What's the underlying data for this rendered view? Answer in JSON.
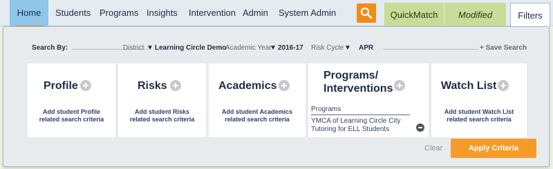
{
  "nav": {
    "items": [
      "Home",
      "Students",
      "Programs",
      "Insights",
      "Intervention",
      "Admin",
      "System Admin"
    ],
    "quickmatch": "QuickMatch",
    "modified": "Modified",
    "filters": "Filters"
  },
  "search": {
    "label": "Search By:",
    "district_label": "District",
    "district_value": "Learning Circle Demo",
    "year_label": "Academic Year",
    "year_value": "2016-17",
    "cycle_label": "Risk Cycle",
    "cycle_value": "APR",
    "save": "+ Save Search"
  },
  "cards": {
    "profile": {
      "title": "Profile",
      "desc1": "Add student Profile",
      "desc2": "related search criteria"
    },
    "risks": {
      "title": "Risks",
      "desc1": "Add student Risks",
      "desc2": "related search criteria"
    },
    "academics": {
      "title": "Academics",
      "desc1": "Add student Academics",
      "desc2": "related search criteria"
    },
    "programs": {
      "title1": "Programs/",
      "title2": "Interventions",
      "sub": "Programs",
      "item1": "YMCA of Learning Circle City",
      "item2": "Tutoring for ELL Students"
    },
    "watchlist": {
      "title": "Watch List",
      "desc1": "Add student Watch List",
      "desc2": "related search criteria"
    }
  },
  "actions": {
    "clear": "Clear",
    "apply": "Apply Criteria"
  },
  "colors": {
    "accent": "#f59b28",
    "nav_active": "#8fc6ea",
    "quickmatch_tab": "#c9dc98"
  }
}
